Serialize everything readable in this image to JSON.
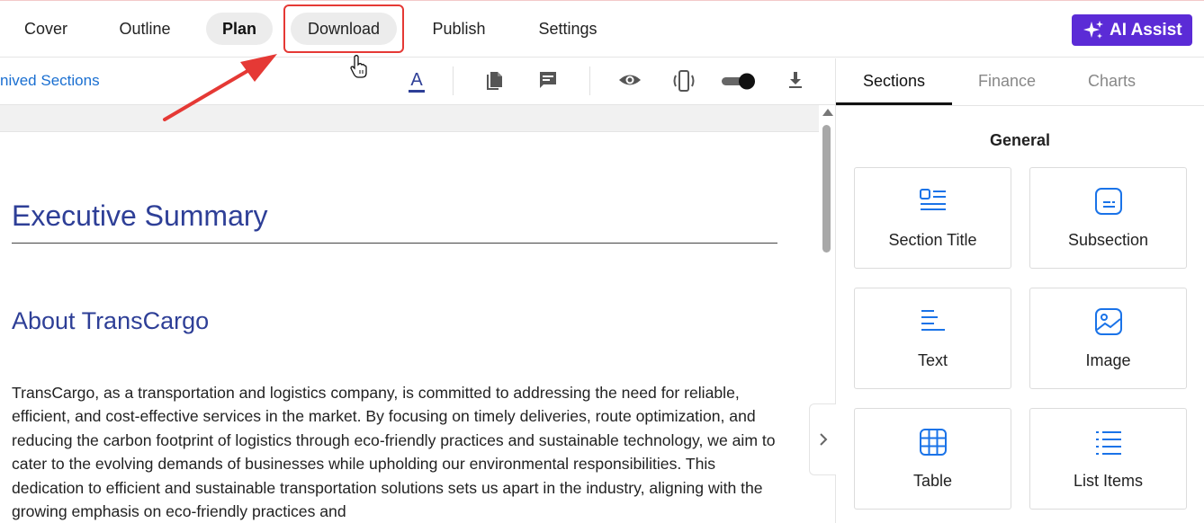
{
  "nav": {
    "tabs": [
      "Cover",
      "Outline",
      "Plan",
      "Download",
      "Publish",
      "Settings"
    ],
    "active": "Plan",
    "highlighted": "Download",
    "ai_assist": "AI Assist"
  },
  "toolbar": {
    "archived_link": "nived Sections"
  },
  "document": {
    "heading": "Executive Summary",
    "subheading": "About TransCargo",
    "paragraph": "TransCargo, as a transportation and logistics company, is committed to addressing the need for reliable, efficient, and cost-effective services in the market. By focusing on timely deliveries, route optimization, and reducing the carbon footprint of logistics through eco-friendly practices and sustainable technology, we aim to cater to the evolving demands of businesses while upholding our environmental responsibilities. This dedication to efficient and sustainable transportation solutions sets us apart in the industry, aligning with the growing emphasis on eco-friendly practices and"
  },
  "side_panel": {
    "tabs": [
      "Sections",
      "Finance",
      "Charts"
    ],
    "active_tab": "Sections",
    "group_title": "General",
    "cards": [
      "Section Title",
      "Subsection",
      "Text",
      "Image",
      "Table",
      "List Items"
    ]
  },
  "colors": {
    "accent": "#5b2bd6",
    "heading": "#2e3f97",
    "link": "#1a6fd1",
    "icon_blue": "#1a73e8",
    "annotation_red": "#e53935"
  }
}
